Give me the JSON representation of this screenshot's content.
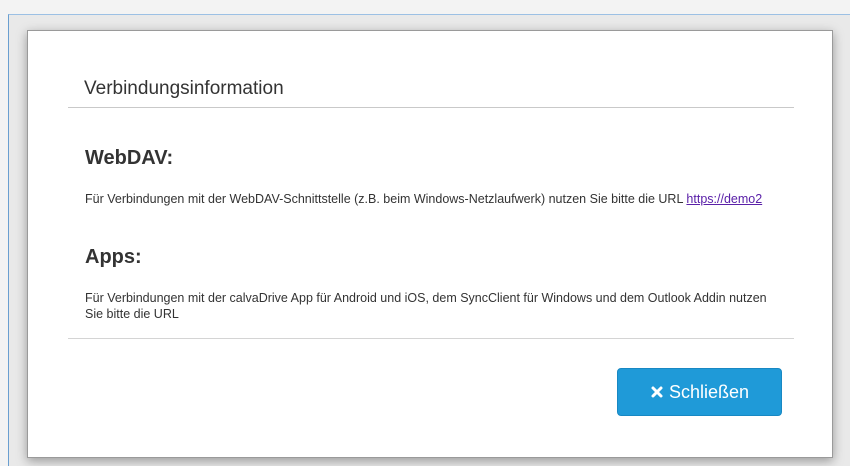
{
  "modal": {
    "title": "Verbindungsinformation",
    "webdav": {
      "heading": "WebDAV:",
      "text": "Für Verbindungen mit der WebDAV-Schnittstelle (z.B. beim Windows-Netzlaufwerk) nutzen Sie bitte die URL ",
      "link": "https://demo2"
    },
    "apps": {
      "heading": "Apps:",
      "text": "Für Verbindungen mit der calvaDrive App für Android und iOS, dem SyncClient für Windows und dem Outlook Addin nutzen Sie bitte die URL"
    },
    "close_button": {
      "icon": "close-icon",
      "label": "Schließen",
      "color": "#1f9ad8"
    }
  }
}
